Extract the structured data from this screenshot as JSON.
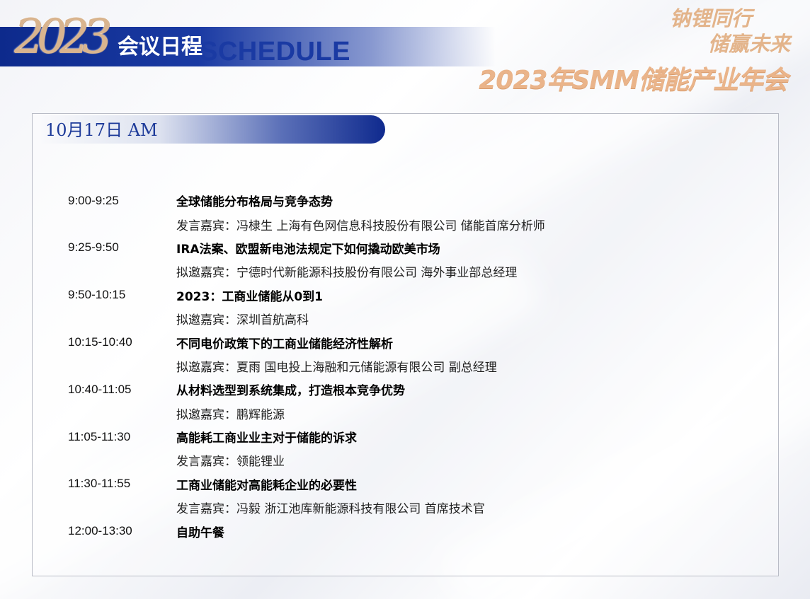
{
  "header": {
    "year_logo": "2023",
    "title": "会议日程",
    "title_en": "SCHEDULE"
  },
  "branding": {
    "slogan_line1": "钠锂同行",
    "slogan_line2": "储赢未来",
    "event_title": "2023年SMM储能产业年会"
  },
  "session": {
    "date": "10月17日 AM"
  },
  "agenda": [
    {
      "time": "9:00-9:25",
      "topic": "全球储能分布格局与竞争态势",
      "speaker": "发言嘉宾：冯棣生 上海有色网信息科技股份有限公司 储能首席分析师"
    },
    {
      "time": "9:25-9:50",
      "topic": "IRA法案、欧盟新电池法规定下如何撬动欧美市场",
      "speaker": "拟邀嘉宾：宁德时代新能源科技股份有限公司 海外事业部总经理"
    },
    {
      "time": "9:50-10:15",
      "topic": "2023：工商业储能从0到1",
      "speaker": "拟邀嘉宾：深圳首航高科"
    },
    {
      "time": "10:15-10:40",
      "topic": "不同电价政策下的工商业储能经济性解析",
      "speaker": "拟邀嘉宾：夏雨 国电投上海融和元储能源有限公司 副总经理"
    },
    {
      "time": "10:40-11:05",
      "topic": "从材料选型到系统集成，打造根本竞争优势",
      "speaker": "拟邀嘉宾：鹏辉能源"
    },
    {
      "time": "11:05-11:30",
      "topic": "高能耗工商业业主对于储能的诉求",
      "speaker": "发言嘉宾：领能锂业"
    },
    {
      "time": "11:30-11:55",
      "topic": "工商业储能对高能耗企业的必要性",
      "speaker": "发言嘉宾：冯毅 浙江池库新能源科技有限公司 首席技术官"
    },
    {
      "time": "12:00-13:30",
      "topic": "自助午餐",
      "speaker": ""
    }
  ],
  "colors": {
    "brand_blue": "#1a3aa3",
    "gold": "#e3b48b"
  }
}
